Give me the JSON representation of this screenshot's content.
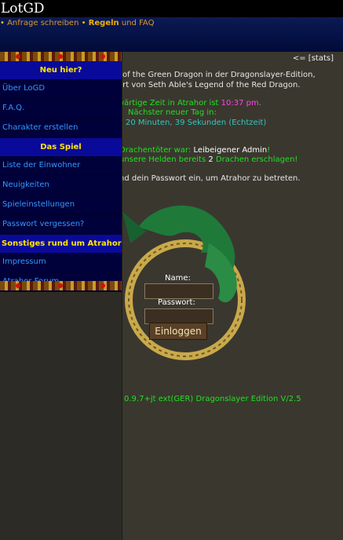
{
  "site": {
    "title": "LotGD"
  },
  "header": {
    "links": [
      {
        "prefix": "•",
        "label": "Anfrage schreiben"
      },
      {
        "prefix": "•",
        "label": "Regeln",
        "suffix": "und FAQ"
      }
    ]
  },
  "main": {
    "stats_link": "<= [stats]",
    "intro_line1": "l of the Green Dragon in der Dragonslayer-Edition,",
    "intro_line2": "ert von Seth Able's Legend of the Red Dragon.",
    "time_prefix": "wärtige Zeit in Atrahor ist",
    "time_value": "10:37 pm",
    "time_suffix": ".",
    "next_day_label": "Nächster neuer Tag in:",
    "next_day_value": "20 Minuten, 39 Sekunden (Echtzeit)",
    "dragonslayer_prefix": "Drachentöter war:",
    "dragonslayer_name": "Leibeigener Admin",
    "dragonslayer_suffix": "!",
    "heroes_prefix": "unsere Helden bereits",
    "heroes_count": "2",
    "heroes_suffix": "Drachen erschlagen!",
    "login_prompt": "nd dein Passwort ein, um Atrahor zu betreten.",
    "version": "0.9.7+jt ext(GER) Dragonslayer Edition V/2.5"
  },
  "login": {
    "name_label": "Name:",
    "password_label": "Passwort:",
    "submit_label": "Einloggen"
  },
  "sidebar": {
    "sections": [
      {
        "heading": "Neu hier?",
        "items": [
          "Über LoGD",
          "F.A.Q.",
          "Charakter erstellen"
        ]
      },
      {
        "heading": "Das Spiel",
        "items": [
          "Liste der Einwohner",
          "Neuigkeiten",
          "Spieleinstellungen",
          "Passwort vergessen?"
        ]
      },
      {
        "heading": "Sonstiges rund um Atrahor",
        "items": [
          "Impressum",
          "Atrahor Forum"
        ]
      }
    ]
  },
  "colors": {
    "menu_heading_bg": "#0a0a9a",
    "menu_heading_text": "#ffe600",
    "menu_item_text": "#3399ff",
    "highlight_green": "#22e022",
    "time_magenta": "#ff44e6"
  }
}
